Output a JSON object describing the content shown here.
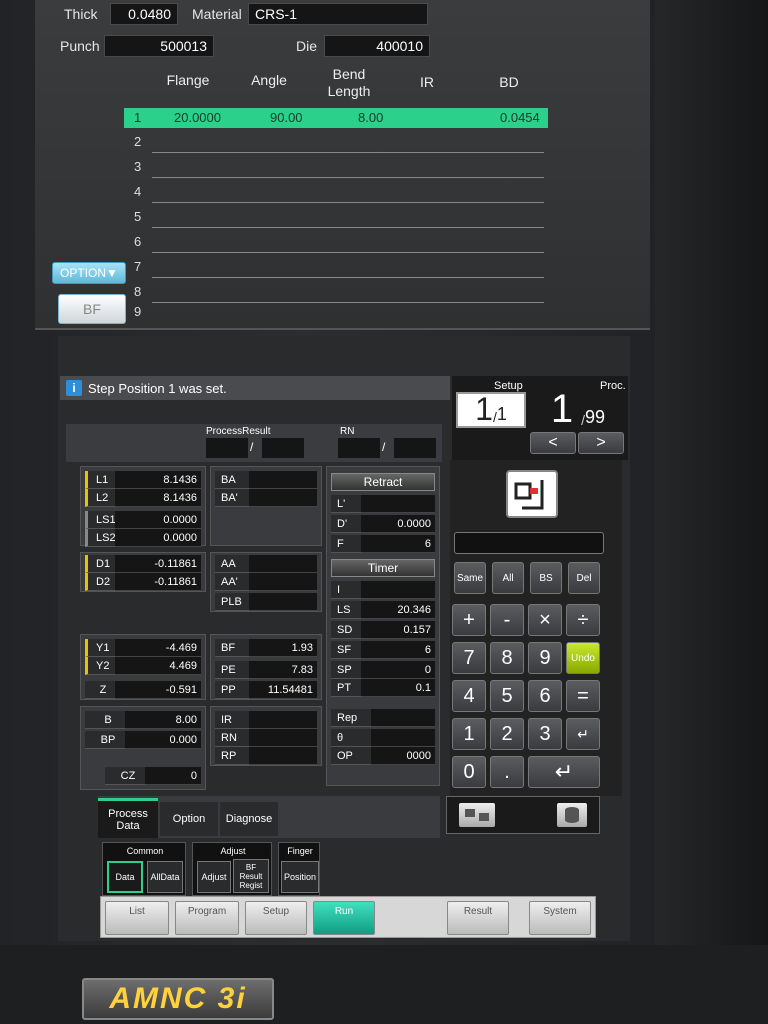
{
  "header": {
    "thick_label": "Thick",
    "thick_value": "0.0480",
    "material_label": "Material",
    "material_value": "CRS-1",
    "punch_label": "Punch",
    "punch_value": "500013",
    "die_label": "Die",
    "die_value": "400010"
  },
  "table": {
    "columns": [
      "Flange",
      "Angle",
      "Bend\nLength",
      "IR",
      "BD"
    ],
    "rows": [
      {
        "num": "1",
        "flange": "20.0000",
        "angle": "90.00",
        "bend": "8.00",
        "ir": "",
        "bd": "0.0454"
      },
      {
        "num": "2"
      },
      {
        "num": "3"
      },
      {
        "num": "4"
      },
      {
        "num": "5"
      },
      {
        "num": "6"
      },
      {
        "num": "7"
      },
      {
        "num": "8"
      },
      {
        "num": "9"
      }
    ]
  },
  "side": {
    "option_label": "OPTION▼",
    "bf_label": "BF"
  },
  "steps": [
    "1",
    "2",
    "3",
    "4",
    "5",
    "6",
    "7",
    "8"
  ],
  "message": "Step Position 1 was set.",
  "setup": {
    "label": "Setup",
    "value": "1",
    "total": "1"
  },
  "proc": {
    "label": "Proc.",
    "value": "1",
    "total": "99"
  },
  "arrows": {
    "left": "<",
    "right": ">"
  },
  "results": {
    "process_result": "ProcessResult",
    "rn": "RN",
    "sep": "/"
  },
  "left": {
    "L1": "8.1436",
    "L2": "8.1436",
    "LS1": "0.0000",
    "LS2": "0.0000",
    "D1": "-0.11861",
    "D2": "-0.11861",
    "Y1": "-4.469",
    "Y2": "4.469",
    "Z": "-0.591",
    "B": "8.00",
    "BP": "0.000",
    "CZ": "0"
  },
  "mid": {
    "BA": "BA",
    "BAp": "BA'",
    "AA": "AA",
    "AAp": "AA'",
    "PLB": "PLB",
    "BF": "1.93",
    "PE": "7.83",
    "PP": "11.54481",
    "IR": "IR",
    "RN": "RN",
    "RP": "RP"
  },
  "retract": {
    "title": "Retract",
    "L": "",
    "D": "0.0000",
    "F": "6"
  },
  "timer": {
    "title": "Timer",
    "I": "",
    "LS": "20.346",
    "SD": "0.157",
    "SF": "6",
    "SP": "0",
    "PT": "0.1"
  },
  "rep": {
    "Rep": "",
    "theta": "",
    "OP": "0000"
  },
  "keypad": {
    "row1": [
      "Same",
      "All",
      "BS",
      "Del"
    ],
    "row2": [
      "+",
      "-",
      "×",
      "÷"
    ],
    "row3": [
      "7",
      "8",
      "9",
      "Undo"
    ],
    "row4": [
      "4",
      "5",
      "6",
      "="
    ],
    "row5": [
      "1",
      "2",
      "3",
      "↵"
    ],
    "row6": [
      "0",
      ".",
      "↵"
    ]
  },
  "bottom_tabs": [
    "Process\nData",
    "Option",
    "Diagnose"
  ],
  "sub": {
    "common": "Common",
    "adjust": "Adjust",
    "finger": "Finger",
    "data": "Data",
    "alldata": "AllData",
    "adjust_btn": "Adjust",
    "bf_result": "BF\nResult\nRegist",
    "position": "Position"
  },
  "nav": [
    "List",
    "Program",
    "Setup",
    "Run",
    "Result",
    "System"
  ],
  "logo": "AMNC 3i"
}
